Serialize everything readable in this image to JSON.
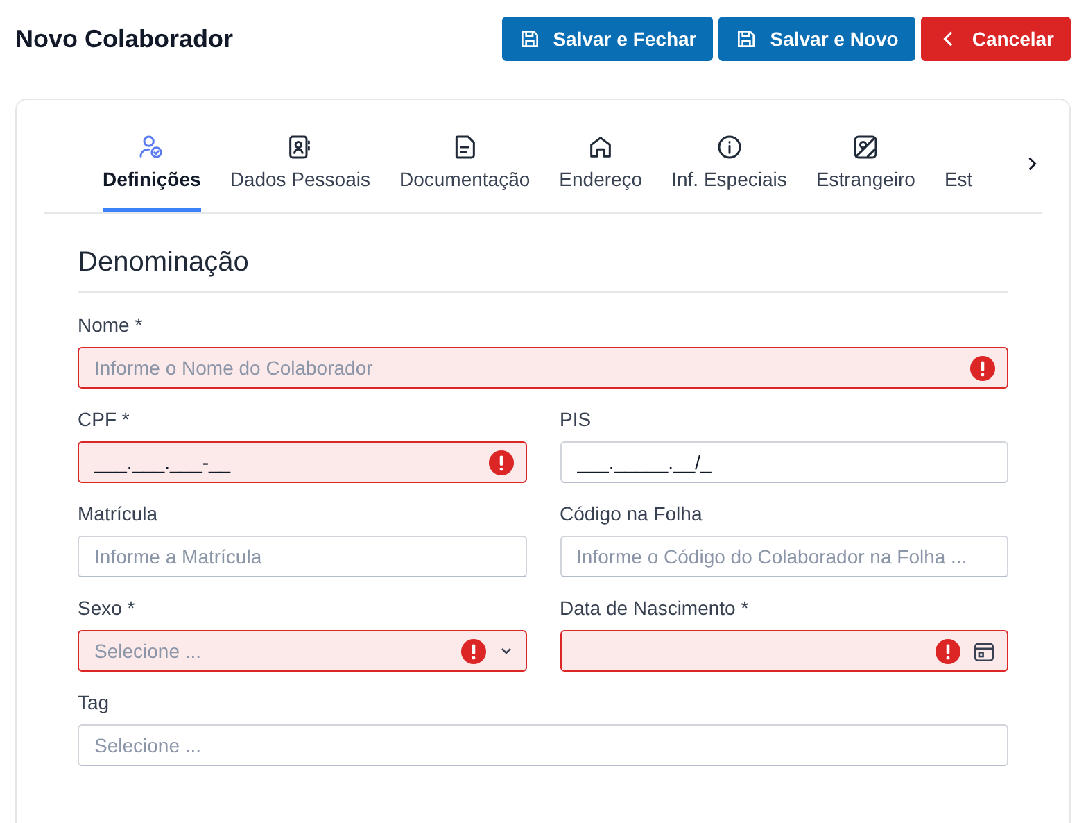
{
  "page": {
    "title": "Novo Colaborador"
  },
  "actions": [
    {
      "label": "Salvar e Fechar",
      "kind": "save"
    },
    {
      "label": "Salvar e Novo",
      "kind": "save"
    },
    {
      "label": "Cancelar",
      "kind": "cancel"
    }
  ],
  "tabs": [
    {
      "label": "Definições",
      "selected": true
    },
    {
      "label": "Dados Pessoais",
      "selected": false
    },
    {
      "label": "Documentação",
      "selected": false
    },
    {
      "label": "Endereço",
      "selected": false
    },
    {
      "label": "Inf. Especiais",
      "selected": false
    },
    {
      "label": "Estrangeiro",
      "selected": false
    },
    {
      "label": "Est",
      "selected": false
    }
  ],
  "section": {
    "title": "Denominação"
  },
  "rows": [
    [
      {
        "label": "Nome *",
        "kind": "text",
        "placeholder": "Informe o Nome do Colaborador",
        "invalid": true
      }
    ],
    [
      {
        "label": "CPF *",
        "kind": "text",
        "value": "___.___.___-__",
        "invalid": true
      },
      {
        "label": "PIS",
        "kind": "text",
        "value": "___._____.__/_",
        "invalid": false
      }
    ],
    [
      {
        "label": "Matrícula",
        "kind": "text",
        "placeholder": "Informe a Matrícula",
        "invalid": false
      },
      {
        "label": "Código na Folha",
        "kind": "text",
        "placeholder": "Informe o Código do Colaborador na Folha ...",
        "invalid": false
      }
    ],
    [
      {
        "label": "Sexo *",
        "kind": "select",
        "placeholder": "Selecione ...",
        "invalid": true
      },
      {
        "label": "Data de Nascimento *",
        "kind": "date",
        "invalid": true
      }
    ],
    [
      {
        "label": "Tag",
        "kind": "text",
        "placeholder": "Selecione ...",
        "invalid": false
      }
    ]
  ]
}
